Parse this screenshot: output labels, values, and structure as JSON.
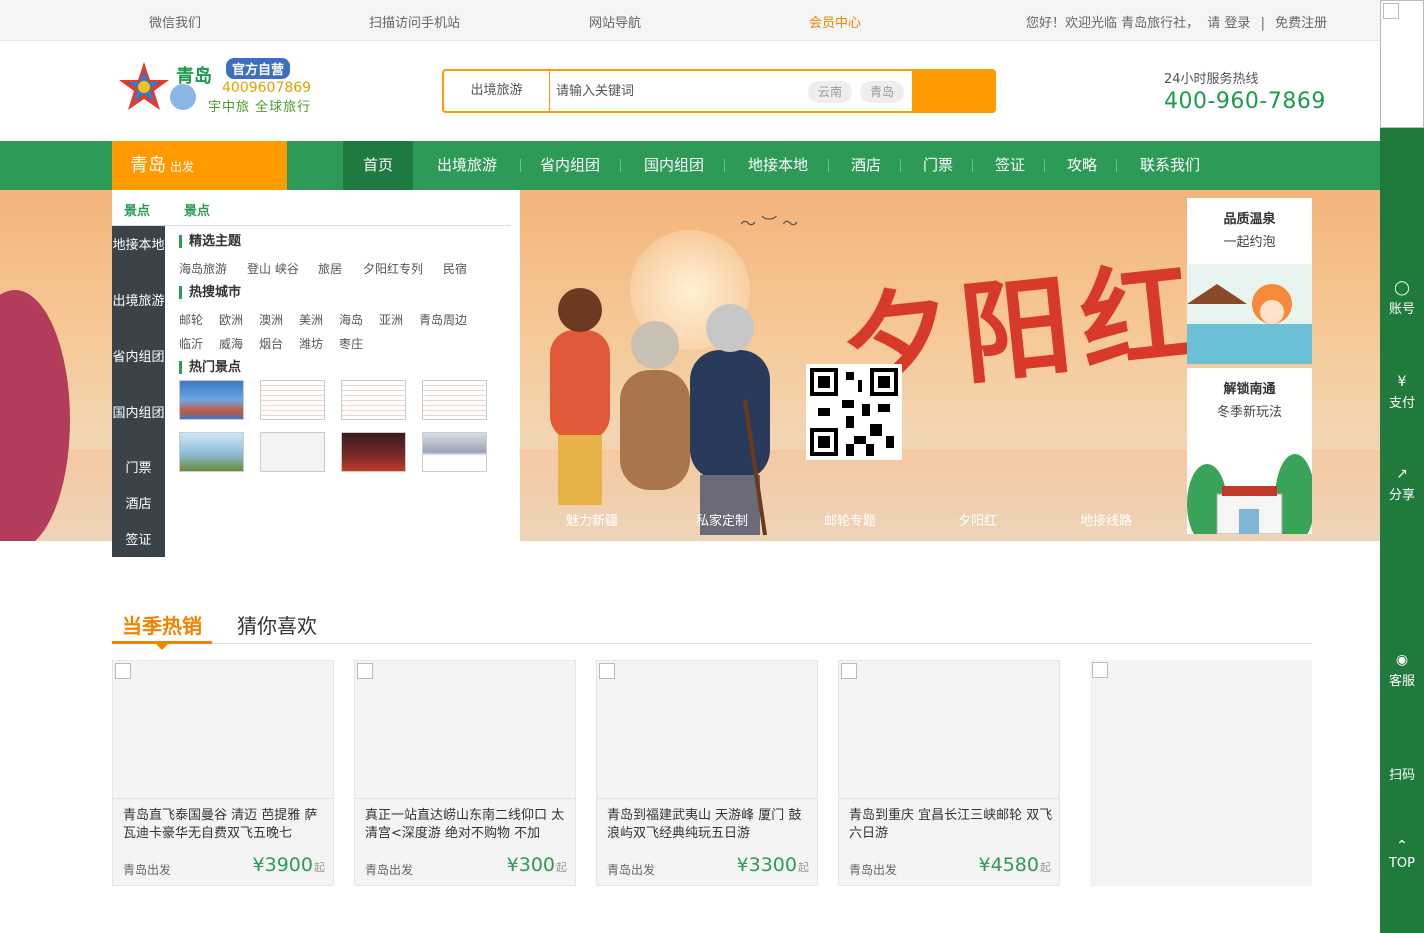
{
  "topbar": {
    "wechat": "微信我们",
    "mobile": "扫描访问手机站",
    "sitenav": "网站导航",
    "member": "会员中心",
    "welcome": "您好！欢迎光临 青岛旅行社，",
    "login": "请 登录",
    "divider": "|",
    "register": "免费注册"
  },
  "logo": {
    "brand": "青岛",
    "tag": "官方自营",
    "phone": "4009607869",
    "slogan": "宇中旅 全球旅行"
  },
  "search": {
    "category": "出境旅游",
    "placeholder": "请输入关键词",
    "keywords": [
      "云南",
      "青岛"
    ]
  },
  "hotline": {
    "label": "24小时服务热线",
    "number": "400-960-7869"
  },
  "nav": {
    "city": "青岛",
    "city_suffix": "出发",
    "items": [
      "首页",
      "出境旅游",
      "省内组团",
      "国内组团",
      "地接本地",
      "酒店",
      "门票",
      "签证",
      "攻略",
      "联系我们"
    ]
  },
  "category_menu": {
    "items": [
      "地接本地",
      "出境旅游",
      "省内组团",
      "国内组团",
      "门票",
      "酒店",
      "签证"
    ]
  },
  "panel": {
    "tabs": [
      "景点",
      "景点"
    ],
    "themes_title": "精选主题",
    "themes": [
      "海岛旅游",
      "登山 峡谷",
      "旅居",
      "夕阳红专列",
      "民宿"
    ],
    "cities_title": "热搜城市",
    "cities": [
      "邮轮",
      "欧洲",
      "澳洲",
      "美洲",
      "海岛",
      "亚洲",
      "青岛周边",
      "临沂",
      "威海",
      "烟台",
      "潍坊",
      "枣庄"
    ],
    "spots_title": "热门景点"
  },
  "banner": {
    "headline": "夕阳红",
    "tabs": [
      "魅力新疆",
      "私家定制",
      "邮轮专题",
      "夕阳红",
      "地接线路"
    ]
  },
  "promos": [
    {
      "title": "品质温泉",
      "subtitle": "一起约泡"
    },
    {
      "title": "解锁南通",
      "subtitle": "冬季新玩法"
    }
  ],
  "hot": {
    "tabs": [
      "当季热销",
      "猜你喜欢"
    ],
    "cards": [
      {
        "title": "青岛直飞泰国曼谷 清迈 芭提雅 萨瓦迪卡豪华无自费双飞五晚七",
        "from": "青岛出发",
        "price": "¥3900",
        "unit": "起"
      },
      {
        "title": "真正一站直达崂山东南二线仰口 太清宫<深度游 绝对不购物 不加",
        "from": "青岛出发",
        "price": "¥300",
        "unit": "起"
      },
      {
        "title": "青岛到福建武夷山 天游峰 厦门 鼓浪屿双飞经典纯玩五日游",
        "from": "青岛出发",
        "price": "¥3300",
        "unit": "起"
      },
      {
        "title": "青岛到重庆 宜昌长江三峡邮轮 双飞六日游",
        "from": "青岛出发",
        "price": "¥4580",
        "unit": "起"
      }
    ]
  },
  "sidebar": {
    "items": [
      "账号",
      "支付",
      "分享",
      "客服",
      "扫码",
      "TOP"
    ]
  },
  "colors": {
    "green": "#2d9b57",
    "orange": "#ff9a00",
    "dark": "#3b434a"
  }
}
